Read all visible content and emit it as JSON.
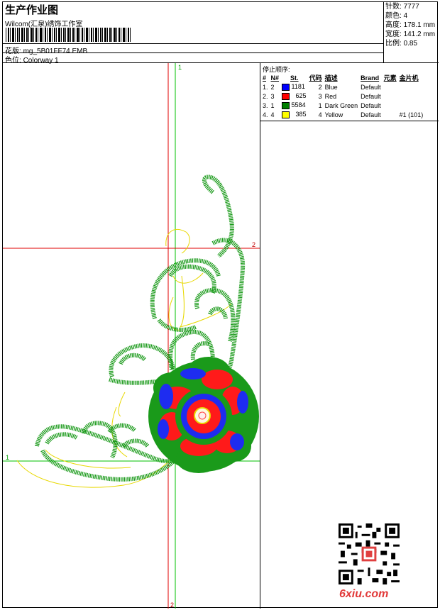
{
  "header": {
    "title": "生产作业图",
    "company": "Wilcom(汇泉)绣饰工作室",
    "pattern_label": "花版:",
    "pattern_file": "mg_5B01FF74.EMB",
    "colorway_label": "色位:",
    "colorway": "Colorway 1"
  },
  "stats": [
    {
      "label": "针数:",
      "value": "7777"
    },
    {
      "label": "颜色:",
      "value": "4"
    },
    {
      "label": "高度:",
      "value": "178.1 mm"
    },
    {
      "label": "宽度:",
      "value": "141.2 mm"
    },
    {
      "label": "比例:",
      "value": "0.85"
    }
  ],
  "stop_sequence": {
    "title": "停止顺序:",
    "headers": [
      "#",
      "N#",
      "St.",
      "代码",
      "描述",
      "Brand",
      "元素",
      "金片机"
    ],
    "rows": [
      {
        "n": "1.",
        "nn": "2",
        "color": "#0000ff",
        "st": "1181",
        "code": "2",
        "desc": "Blue",
        "brand": "Default",
        "extra": ""
      },
      {
        "n": "2.",
        "nn": "3",
        "color": "#ff0000",
        "st": "625",
        "code": "3",
        "desc": "Red",
        "brand": "Default",
        "extra": ""
      },
      {
        "n": "3.",
        "nn": "1",
        "color": "#008000",
        "st": "5584",
        "code": "1",
        "desc": "Dark Green",
        "brand": "Default",
        "extra": ""
      },
      {
        "n": "4.",
        "nn": "4",
        "color": "#ffff00",
        "st": "385",
        "code": "4",
        "desc": "Yellow",
        "brand": "Default",
        "extra": "#1 (101)"
      }
    ]
  },
  "guides": {
    "v_green_label_top": "1",
    "h_red_label_right": "2",
    "h_green_label_left": "1",
    "v_red_label_bottom": "2"
  },
  "watermark": "6xiu.com",
  "colors": {
    "green": "#1a9a1a",
    "red": "#ff0000",
    "blue": "#1e2cf0",
    "yellow": "#f0e000",
    "guide_red": "#e00000",
    "guide_green": "#00c000"
  }
}
